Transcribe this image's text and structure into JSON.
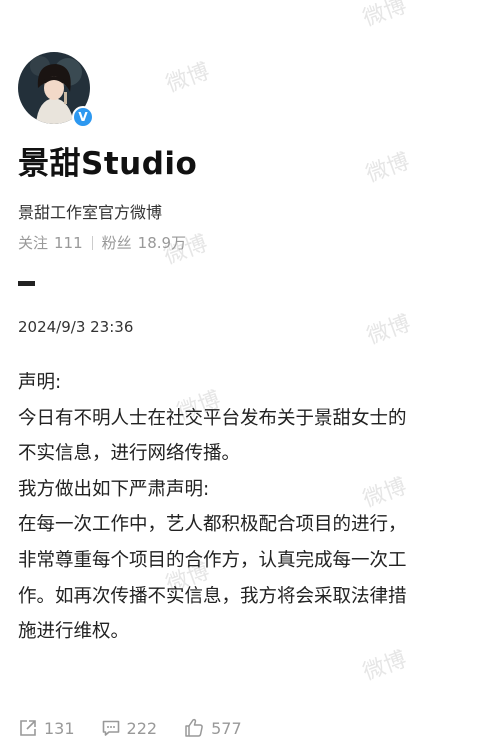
{
  "profile": {
    "name": "景甜Studio",
    "bio": "景甜工作室官方微博",
    "following_label": "关注",
    "following_count": "111",
    "followers_label": "粉丝",
    "followers_count": "18.9万",
    "verified_glyph": "V"
  },
  "post": {
    "date": "2024/9/3 23:36",
    "lines": [
      "声明:",
      "今日有不明人士在社交平台发布关于景甜女士的",
      "不实信息，进行网络传播。",
      "我方做出如下严肃声明:",
      "在每一次工作中，艺人都积极配合项目的进行，",
      "非常尊重每个项目的合作方，认真完成每一次工",
      "作。如再次传播不实信息，我方将会采取法律措",
      "施进行维权。"
    ]
  },
  "actions": {
    "repost_count": "131",
    "comment_count": "222",
    "like_count": "577"
  },
  "watermark": {
    "text": "微博"
  },
  "colors": {
    "verified_badge": "#2d98f0",
    "muted_text": "#999999"
  },
  "icons": [
    "repost-icon",
    "comment-icon",
    "like-icon",
    "verified-icon"
  ]
}
